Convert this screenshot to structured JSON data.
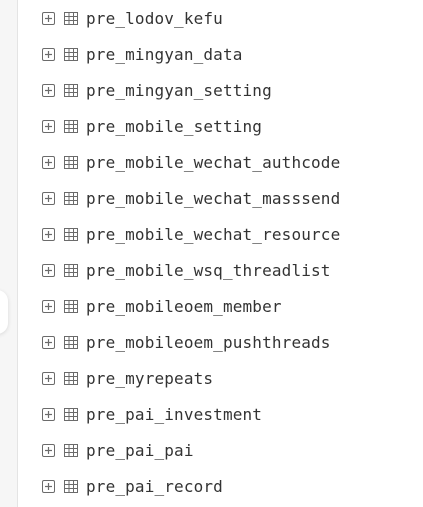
{
  "tree": {
    "colors": {
      "text": "#333333",
      "icon": "#6b6b6b"
    },
    "items": [
      {
        "label": "pre_lodov_kefu",
        "expander_icon": "plus-square-icon",
        "type_icon": "table-icon"
      },
      {
        "label": "pre_mingyan_data",
        "expander_icon": "plus-square-icon",
        "type_icon": "table-icon"
      },
      {
        "label": "pre_mingyan_setting",
        "expander_icon": "plus-square-icon",
        "type_icon": "table-icon"
      },
      {
        "label": "pre_mobile_setting",
        "expander_icon": "plus-square-icon",
        "type_icon": "table-icon"
      },
      {
        "label": "pre_mobile_wechat_authcode",
        "expander_icon": "plus-square-icon",
        "type_icon": "table-icon"
      },
      {
        "label": "pre_mobile_wechat_masssend",
        "expander_icon": "plus-square-icon",
        "type_icon": "table-icon"
      },
      {
        "label": "pre_mobile_wechat_resource",
        "expander_icon": "plus-square-icon",
        "type_icon": "table-icon"
      },
      {
        "label": "pre_mobile_wsq_threadlist",
        "expander_icon": "plus-square-icon",
        "type_icon": "table-icon"
      },
      {
        "label": "pre_mobileoem_member",
        "expander_icon": "plus-square-icon",
        "type_icon": "table-icon"
      },
      {
        "label": "pre_mobileoem_pushthreads",
        "expander_icon": "plus-square-icon",
        "type_icon": "table-icon"
      },
      {
        "label": "pre_myrepeats",
        "expander_icon": "plus-square-icon",
        "type_icon": "table-icon"
      },
      {
        "label": "pre_pai_investment",
        "expander_icon": "plus-square-icon",
        "type_icon": "table-icon"
      },
      {
        "label": "pre_pai_pai",
        "expander_icon": "plus-square-icon",
        "type_icon": "table-icon"
      },
      {
        "label": "pre_pai_record",
        "expander_icon": "plus-square-icon",
        "type_icon": "table-icon"
      }
    ]
  }
}
